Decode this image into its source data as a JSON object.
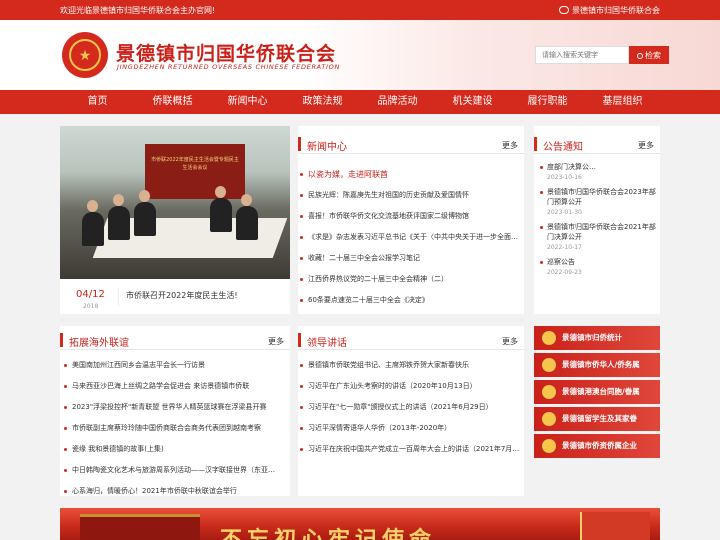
{
  "topbar": {
    "welcome": "欢迎光临景德镇市归国华侨联合会主办官网!",
    "contact": "景德镇市归国华侨联合会"
  },
  "header": {
    "title": "景德镇市归国华侨联合会",
    "subtitle": "JINGDEZHEN RETURNED OVERSEAS CHINESE FEDERATION",
    "search_placeholder": "请输入搜索关键字",
    "search_button": "检索"
  },
  "nav": [
    "首页",
    "侨联概括",
    "新闻中心",
    "政策法规",
    "品牌活动",
    "机关建设",
    "履行职能",
    "基层组织"
  ],
  "slide": {
    "date": "04/12",
    "year": "2018",
    "caption": "市侨联召开2022年度民主生活!",
    "screen_text": "市侨联2022年度民主生活会暨专题民主生活会会议"
  },
  "news": {
    "title": "新闻中心",
    "more": "更多",
    "items": [
      "以瓷为媒，走进阿联酋",
      "民族光辉：陈嘉庚先生对祖国的历史贡献及爱国情怀",
      "喜报！市侨联华侨文化交流基地获评国家二级博物馆",
      "《求是》杂志发表习近平总书记《关于〈中共中央关于进一步全面…",
      "收藏！二十届三中全会公报学习笔记",
      "江西侨界热议党的二十届三中全会精神（二）",
      "60条要点速览二十届三中全会《决定》"
    ]
  },
  "notice": {
    "title": "公告通知",
    "more": "更多",
    "items": [
      {
        "title": "度部门决算公…",
        "date": "2023-10-16"
      },
      {
        "title": "景德镇市归国华侨联合会2023年部门预算公开",
        "date": "2023-01-30"
      },
      {
        "title": "景德镇市归国华侨联合会2021年部门决算公开",
        "date": "2022-10-17"
      },
      {
        "title": "巡察公告",
        "date": "2022-09-23"
      }
    ]
  },
  "overseas": {
    "title": "拓展海外联谊",
    "more": "更多",
    "items": [
      "美国南加州江西同乡会温志平会长一行访景",
      "马来西亚沙巴海上丝绸之路学会促进会 来访景德镇市侨联",
      "2023\"浮梁投控杯\"新青联盟 世界华人精英篮球赛在浮梁县开赛",
      "市侨联副主席蔡玲玲随中国侨商联合会商务代表团到越南考察",
      "瓷缘 我和景德镇的故事(上集)",
      "中日韩陶瓷文化艺术与旅游周系列活动——汉字联接世界（东亚…",
      "心系海归，情暖侨心！2021年市侨联中秋联谊会举行"
    ]
  },
  "leaders": {
    "title": "领导讲话",
    "more": "更多",
    "items": [
      "景德镇市侨联党组书记、主席郑铁乔贺大家新春快乐",
      "习近平在广东汕头考察时的讲话（2020年10月13日）",
      "习近平在\"七一勋章\"颁授仪式上的讲话（2021年6月29日）",
      "习近平深情寄语华人华侨（2013年-2020年）",
      "习近平在庆祝中国共产党成立一百周年大会上的讲话（2021年7月…"
    ]
  },
  "side_buttons": [
    "景德镇市归侨统计",
    "景德镇市侨华人/侨务属",
    "景德镇港澳台同胞/眷属",
    "景德镇留学生及其家眷",
    "景德镇市侨资侨属企业"
  ],
  "banner": {
    "slogan": "不忘初心牢记使命"
  },
  "colors": {
    "brand_red": "#d42a1e",
    "gold": "#f5c64c"
  }
}
